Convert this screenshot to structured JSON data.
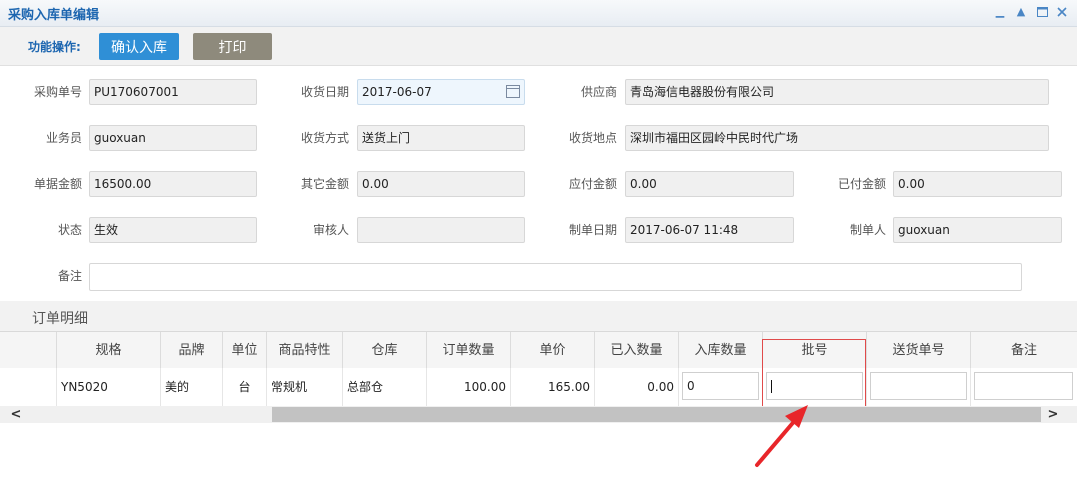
{
  "window": {
    "title": "采购入库单编辑",
    "controls": [
      "minimize-icon",
      "collapse-up-icon",
      "maximize-icon",
      "close-icon"
    ]
  },
  "toolbar": {
    "label": "功能操作:",
    "confirm_label": "确认入库",
    "print_label": "打印"
  },
  "form": {
    "po_no_label": "采购单号",
    "po_no": "PU170607001",
    "receive_date_label": "收货日期",
    "receive_date": "2017-06-07",
    "supplier_label": "供应商",
    "supplier": "青岛海信电器股份有限公司",
    "salesman_label": "业务员",
    "salesman": "guoxuan",
    "receive_method_label": "收货方式",
    "receive_method": "送货上门",
    "receive_place_label": "收货地点",
    "receive_place": "深圳市福田区园岭中民时代广场",
    "doc_amount_label": "单据金额",
    "doc_amount": "16500.00",
    "other_amount_label": "其它金额",
    "other_amount": "0.00",
    "payable_label": "应付金额",
    "payable": "0.00",
    "paid_label": "已付金额",
    "paid": "0.00",
    "status_label": "状态",
    "status": "生效",
    "reviewer_label": "审核人",
    "reviewer": "",
    "created_date_label": "制单日期",
    "created_date": "2017-06-07 11:48",
    "creator_label": "制单人",
    "creator": "guoxuan",
    "remark_label": "备注",
    "remark": ""
  },
  "details": {
    "title": "订单明细",
    "columns": [
      "规格",
      "品牌",
      "单位",
      "商品特性",
      "仓库",
      "订单数量",
      "单价",
      "已入数量",
      "入库数量",
      "批号",
      "送货单号",
      "备注"
    ],
    "rows": [
      {
        "spec": "YN5020",
        "brand": "美的",
        "unit": "台",
        "feature": "常规机",
        "warehouse": "总部仓",
        "order_qty": "100.00",
        "price": "165.00",
        "received_qty": "0.00",
        "in_qty": "0",
        "batch_no": "",
        "delivery_no": "",
        "remark": ""
      }
    ]
  },
  "colors": {
    "accent": "#2f8fd6",
    "print_button": "#8e8a7c",
    "highlight": "#e04a4a",
    "title_text": "#1d66b0"
  }
}
